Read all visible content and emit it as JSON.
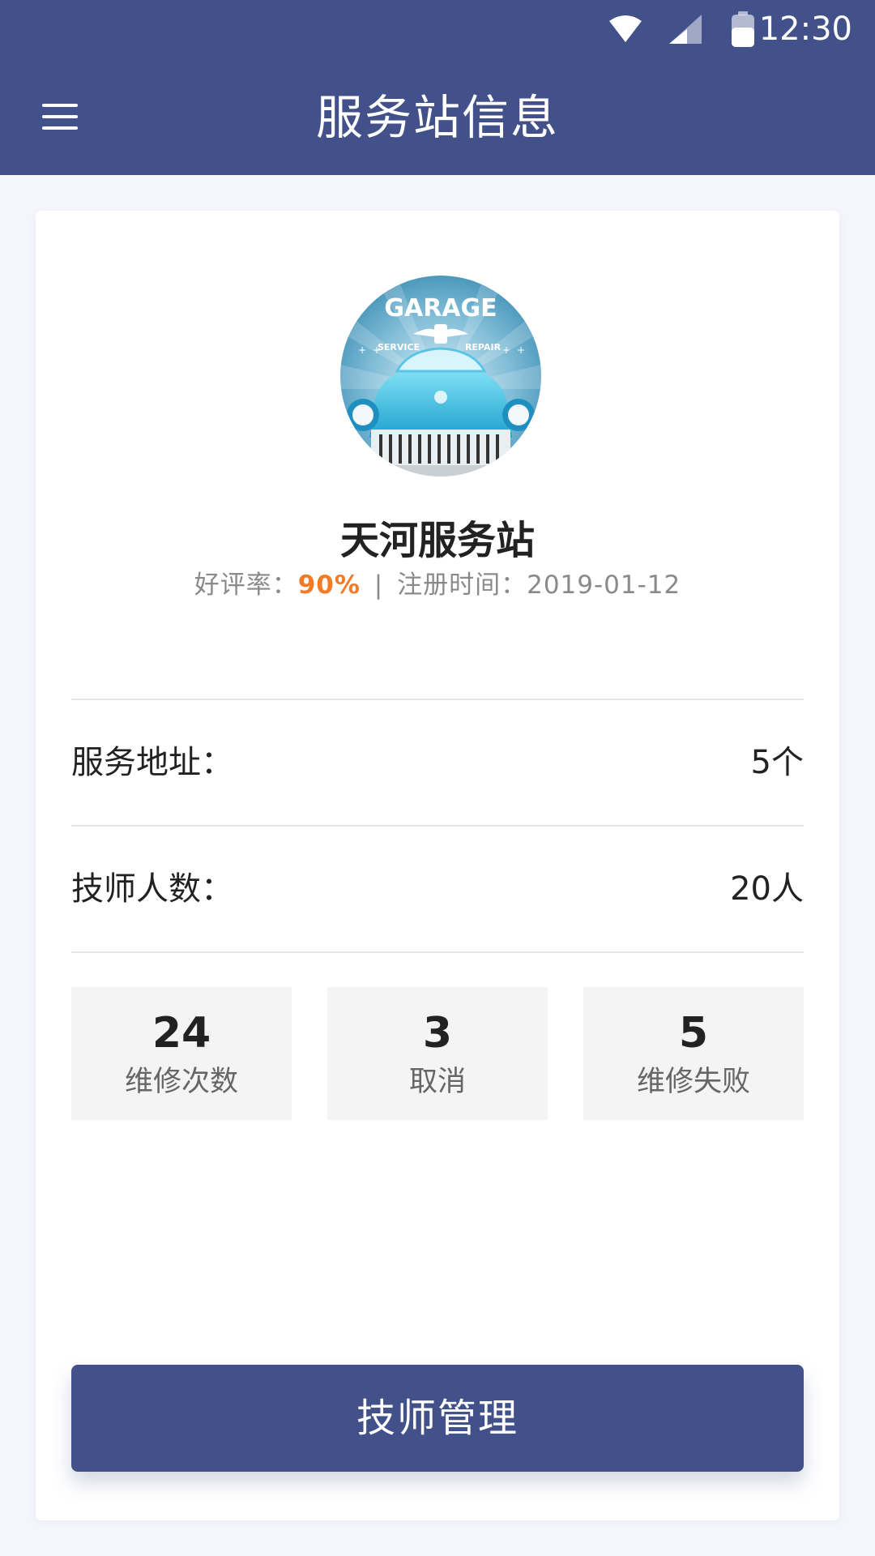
{
  "status_bar": {
    "time": "12:30",
    "icons": [
      "wifi-icon",
      "signal-icon",
      "battery-icon"
    ]
  },
  "header": {
    "title": "服务站信息",
    "menu_icon": "hamburger-menu-icon"
  },
  "station": {
    "name": "天河服务站",
    "rating_label": "好评率：",
    "rating_value": "90%",
    "separator": "|",
    "registered_label": "注册时间：",
    "registered_date": "2019-01-12",
    "logo": {
      "title": "GARAGE",
      "left_text": "SERVICE",
      "right_text": "REPAIR"
    }
  },
  "info_rows": [
    {
      "label": "服务地址：",
      "value": "5个"
    },
    {
      "label": "技师人数：",
      "value": "20人"
    }
  ],
  "stats": [
    {
      "number": "24",
      "label": "维修次数"
    },
    {
      "number": "3",
      "label": "取消"
    },
    {
      "number": "5",
      "label": "维修失败"
    }
  ],
  "action": {
    "button_label": "技师管理"
  },
  "colors": {
    "primary": "#42518a",
    "accent": "#f47b26",
    "background": "#f5f6fb",
    "stat_box": "#f4f4f4"
  }
}
